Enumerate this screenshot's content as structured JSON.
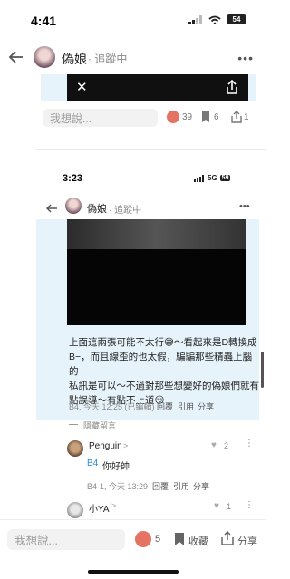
{
  "status_bar": {
    "time": "4:41",
    "battery": "54"
  },
  "nav": {
    "title": "偽娘",
    "follow": "· 追蹤中",
    "more": "•••"
  },
  "outer_post": {
    "reply_placeholder": "我想說...",
    "reactions": "39",
    "saves": "6",
    "shares": "1"
  },
  "inner_screenshot": {
    "status_bar": {
      "time": "3:23",
      "network": "5G",
      "battery": "59"
    },
    "nav": {
      "title": "偽娘",
      "follow": "· 追蹤中",
      "more": "•••"
    },
    "post_text_lines": [
      "上面這兩張可能不太行😅～看起來是D轉換成",
      "B−，而且線歪的也太假，騙騙那些精蟲上腦的",
      "私訊是可以～不過對那些想變好的偽娘們就有",
      "點誤導～有點不上道😏"
    ],
    "post_meta": {
      "floor": "B4, 今天 12:25 (已編輯)",
      "reply": "回覆",
      "quote": "引用",
      "share": "分享"
    },
    "hidden_comments": "隱藏留言",
    "comment1": {
      "user": "Penguin",
      "chevron": ">",
      "likes": "2",
      "mention": "B4",
      "text": "你好帥",
      "meta": "B4-1, 今天 13:29",
      "reply": "回覆",
      "quote": "引用",
      "share": "分享"
    },
    "comment2": {
      "user": "小YA",
      "chevron": ">",
      "likes": "1"
    }
  },
  "bottom_bar": {
    "placeholder": "我想說...",
    "reactions": "5",
    "save": "收藏",
    "share": "分享"
  },
  "colors": {
    "accent_blue": "#1e88e5",
    "quote_bg": "#e7f3fb",
    "heart_red": "#e74c3c"
  }
}
